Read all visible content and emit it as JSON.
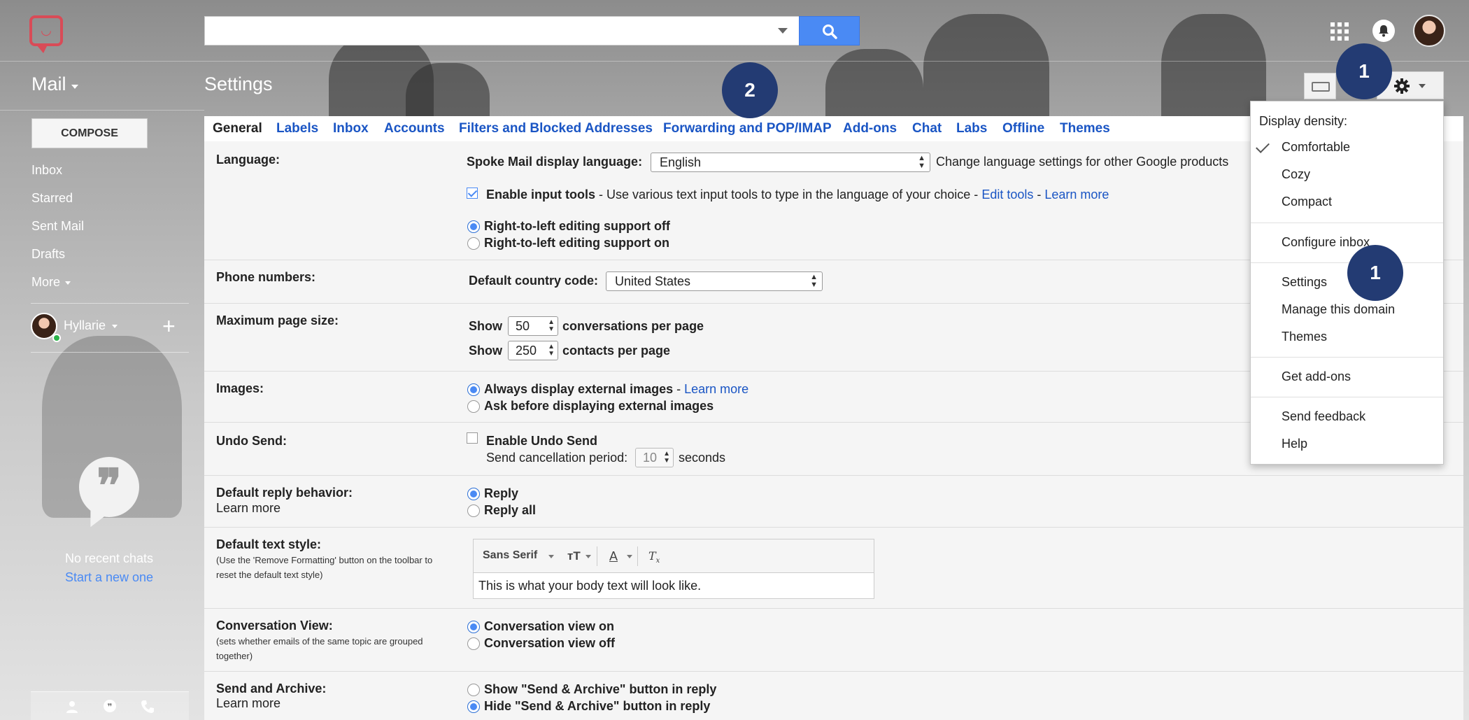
{
  "search": {
    "placeholder": ""
  },
  "header": {
    "app_label": "Mail",
    "page_title": "Settings"
  },
  "sidebar": {
    "compose_label": "COMPOSE",
    "items": [
      {
        "label": "Inbox"
      },
      {
        "label": "Starred"
      },
      {
        "label": "Sent Mail"
      },
      {
        "label": "Drafts"
      },
      {
        "label": "More"
      }
    ],
    "user_name": "Hyllarie",
    "add_label": "+",
    "chat_empty": "No recent chats",
    "chat_start": "Start a new one"
  },
  "tabs": [
    {
      "label": "General"
    },
    {
      "label": "Labels"
    },
    {
      "label": "Inbox"
    },
    {
      "label": "Accounts"
    },
    {
      "label": "Filters and Blocked Addresses"
    },
    {
      "label": "Forwarding and POP/IMAP"
    },
    {
      "label": "Add-ons"
    },
    {
      "label": "Chat"
    },
    {
      "label": "Labs"
    },
    {
      "label": "Offline"
    },
    {
      "label": "Themes"
    }
  ],
  "settings": {
    "language": {
      "label": "Language:",
      "display_label": "Spoke Mail display language:",
      "value": "English",
      "change_link": "Change language settings for other Google products",
      "input_tools_label": "Enable input tools",
      "input_tools_desc": " - Use various text input tools to type in the language of your choice - ",
      "edit_tools": "Edit tools",
      "dash": " - ",
      "learn_more": "Learn more",
      "rtl_off": "Right-to-left editing support off",
      "rtl_on": "Right-to-left editing support on"
    },
    "phone": {
      "label": "Phone numbers:",
      "country_label": "Default country code:",
      "value": "United States"
    },
    "page_size": {
      "label": "Maximum page size:",
      "show": "Show",
      "conversations_value": "50",
      "conversations_suffix": "conversations per page",
      "contacts_value": "250",
      "contacts_suffix": "contacts per page"
    },
    "images": {
      "label": "Images:",
      "always": "Always display external images",
      "dash": " - ",
      "learn_more": "Learn more",
      "ask": "Ask before displaying external images"
    },
    "undo_send": {
      "label": "Undo Send:",
      "enable": "Enable Undo Send",
      "period_label": "Send cancellation period:",
      "period_value": "10",
      "seconds": "seconds"
    },
    "reply": {
      "label": "Default reply behavior:",
      "learn_more": "Learn more",
      "reply": "Reply",
      "reply_all": "Reply all"
    },
    "text_style": {
      "label": "Default text style:",
      "note": "(Use the 'Remove Formatting' button on the toolbar to reset the default text style)",
      "font": "Sans Serif",
      "preview": "This is what your body text will look like."
    },
    "conversation": {
      "label": "Conversation View:",
      "note": "(sets whether emails of the same topic are grouped together)",
      "on": "Conversation view on",
      "off": "Conversation view off"
    },
    "send_archive": {
      "label": "Send and Archive:",
      "learn_more": "Learn more",
      "show": "Show \"Send & Archive\" button in reply",
      "hide": "Hide \"Send & Archive\" button in reply"
    }
  },
  "menu": {
    "heading": "Display density:",
    "density": [
      "Comfortable",
      "Cozy",
      "Compact"
    ],
    "configure": "Configure inbox",
    "group2": [
      "Settings",
      "Manage this domain",
      "Themes"
    ],
    "addons": "Get add-ons",
    "group4": [
      "Send feedback",
      "Help"
    ]
  },
  "callouts": [
    "1",
    "2",
    "1"
  ],
  "colors": {
    "accent": "#4a8af4",
    "link": "#1a55c4",
    "logo": "#d94b57",
    "callout": "#233b73"
  }
}
